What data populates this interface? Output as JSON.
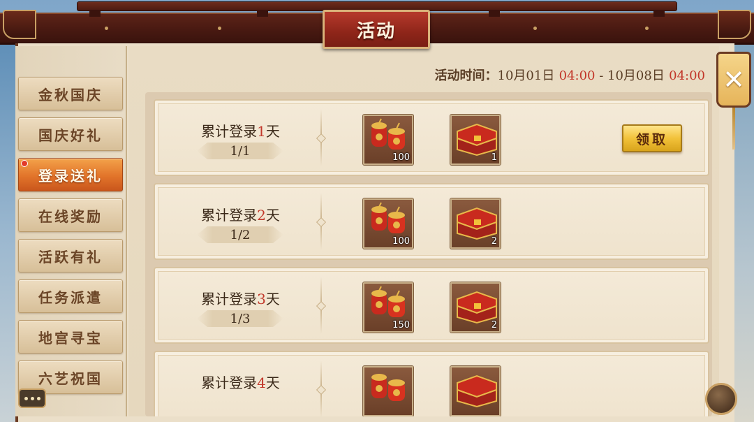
{
  "window": {
    "title": "活动",
    "close_symbol": "✕"
  },
  "sidebar": {
    "items": [
      {
        "label": "金秋国庆",
        "active": false
      },
      {
        "label": "国庆好礼",
        "active": false
      },
      {
        "label": "登录送礼",
        "active": true
      },
      {
        "label": "在线奖励",
        "active": false
      },
      {
        "label": "活跃有礼",
        "active": false
      },
      {
        "label": "任务派遣",
        "active": false
      },
      {
        "label": "地宫寻宝",
        "active": false
      },
      {
        "label": "六艺祝国",
        "active": false
      }
    ]
  },
  "activity_time": {
    "label": "活动时间：",
    "start_date": "10月01日",
    "start_time": "04:00",
    "separator": " - ",
    "end_date": "10月08日",
    "end_time": "04:00"
  },
  "rows": [
    {
      "title_prefix": "累计登录",
      "day": "1",
      "title_suffix": "天",
      "progress": "1/1",
      "reward1_count": "100",
      "reward2_count": "1",
      "claim_label": "领取"
    },
    {
      "title_prefix": "累计登录",
      "day": "2",
      "title_suffix": "天",
      "progress": "1/2",
      "reward1_count": "100",
      "reward2_count": "2"
    },
    {
      "title_prefix": "累计登录",
      "day": "3",
      "title_suffix": "天",
      "progress": "1/3",
      "reward1_count": "150",
      "reward2_count": "2"
    },
    {
      "title_prefix": "累计登录",
      "day": "4",
      "title_suffix": "天",
      "progress": "",
      "reward1_count": "",
      "reward2_count": ""
    }
  ],
  "icons": {
    "reward1": "firecracker-icon",
    "reward2": "treasure-chest-icon",
    "chat": "chat-bubble-icon",
    "menu": "menu-orb-icon"
  },
  "colors": {
    "accent_red": "#c2372a",
    "active_tab": "#e2742a",
    "claim_button": "#f2c23a"
  }
}
